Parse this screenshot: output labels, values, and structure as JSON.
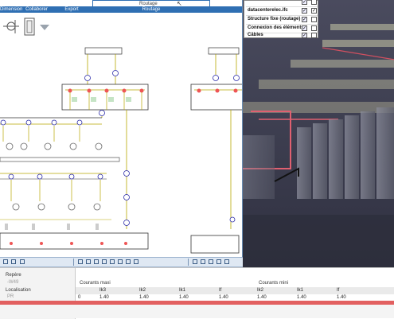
{
  "ribbon": {
    "tabs": [
      "Dimensions",
      "Collaborer",
      "Export",
      "Routage"
    ],
    "routage_top": "Routage",
    "colors": {
      "ribbon_blue": "#2f6fb3"
    }
  },
  "layers_panel": {
    "items": [
      {
        "label": "datacenterelec.ifc",
        "checked": true
      },
      {
        "label": "Structure fixe (routage)",
        "checked": true
      },
      {
        "label": "Connexion des éléments",
        "checked": true
      },
      {
        "label": "Câbles",
        "checked": true
      }
    ],
    "check": "✓"
  },
  "properties": {
    "repere_label": "Repère",
    "repere_value": "-W49",
    "localisation_label": "Localisation",
    "localisation_value": "PR",
    "courants_maxi": "Courants maxi",
    "courants_mini": "Courants mini",
    "columns": [
      "Ik3",
      "Ik2",
      "Ik1",
      "If",
      "Ik2",
      "Ik1",
      "If"
    ],
    "row_index": "0",
    "row_values": [
      "1.40",
      "1.40",
      "1.40",
      "1.40",
      "1.40",
      "1.40",
      "1.40"
    ]
  }
}
